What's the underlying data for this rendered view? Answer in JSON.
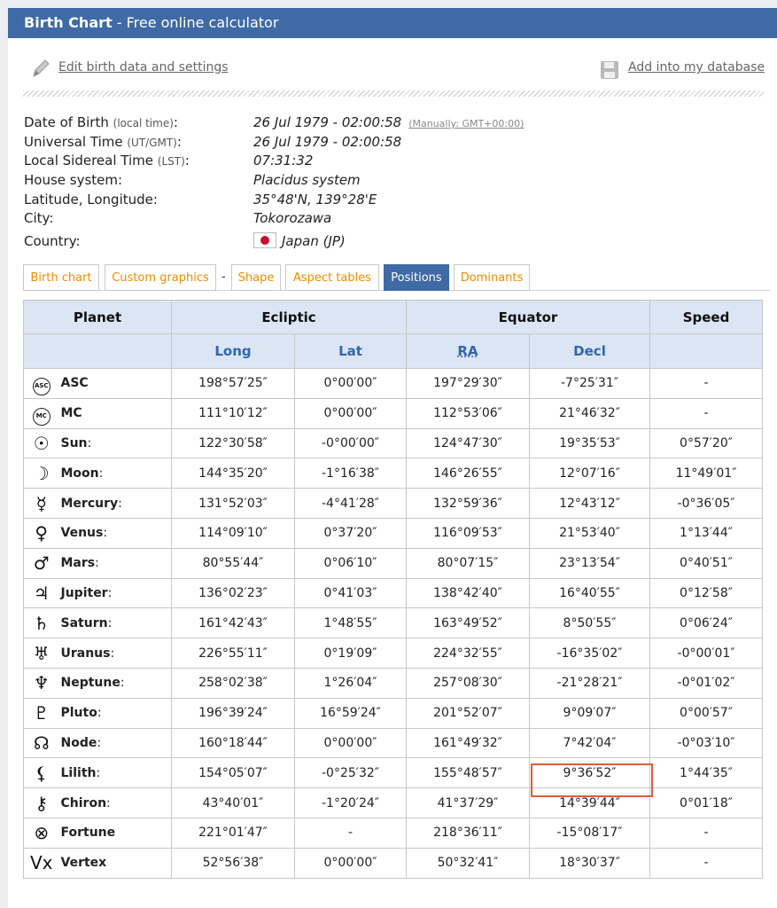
{
  "header": {
    "title": "Birth Chart",
    "subtitle": " - Free online calculator"
  },
  "actions": {
    "edit": "Edit birth data and settings",
    "add": "Add into my database"
  },
  "info": [
    {
      "label": "Date of Birth",
      "note": "(local time)",
      "value": "26 Jul 1979 - 02:00:58",
      "extra": "(Manually: GMT+00:00)"
    },
    {
      "label": "Universal Time",
      "note": "(UT/GMT)",
      "value": "26 Jul 1979 - 02:00:58"
    },
    {
      "label": "Local Sidereal Time",
      "note": "(LST)",
      "value": "07:31:32"
    },
    {
      "label": "House system",
      "note": "",
      "value": "Placidus system"
    },
    {
      "label": "Latitude, Longitude",
      "note": "",
      "value": "35°48'N, 139°28'E"
    },
    {
      "label": "City",
      "note": "",
      "value": "Tokorozawa"
    },
    {
      "label": "Country",
      "note": "",
      "value": "Japan (JP)"
    }
  ],
  "tabs": [
    "Birth chart",
    "Custom graphics",
    "Shape",
    "Aspect tables",
    "Positions",
    "Dominants"
  ],
  "tab_separator": "-",
  "table": {
    "group_headers": [
      "Planet",
      "Ecliptic",
      "Equator",
      "Speed"
    ],
    "sub_headers": [
      "Long",
      "Lat",
      "RA",
      "Decl"
    ],
    "rows": [
      {
        "sym": "ASC",
        "name": "ASC",
        "colon": "",
        "long": "198°57′25″",
        "lat": "0°00′00″",
        "ra": "197°29′30″",
        "decl": "-7°25′31″",
        "speed": "-"
      },
      {
        "sym": "MC",
        "name": "MC",
        "colon": "",
        "long": "111°10′12″",
        "lat": "0°00′00″",
        "ra": "112°53′06″",
        "decl": "21°46′32″",
        "speed": "-"
      },
      {
        "sym": "☉",
        "name": "Sun",
        "colon": ":",
        "long": "122°30′58″",
        "lat": "-0°00′00″",
        "ra": "124°47′30″",
        "decl": "19°35′53″",
        "speed": "0°57′20″"
      },
      {
        "sym": "☽",
        "name": "Moon",
        "colon": ":",
        "long": "144°35′20″",
        "lat": "-1°16′38″",
        "ra": "146°26′55″",
        "decl": "12°07′16″",
        "speed": "11°49′01″"
      },
      {
        "sym": "☿",
        "name": "Mercury",
        "colon": ":",
        "long": "131°52′03″",
        "lat": "-4°41′28″",
        "ra": "132°59′36″",
        "decl": "12°43′12″",
        "speed": "-0°36′05″"
      },
      {
        "sym": "♀",
        "name": "Venus",
        "colon": ":",
        "long": "114°09′10″",
        "lat": "0°37′20″",
        "ra": "116°09′53″",
        "decl": "21°53′40″",
        "speed": "1°13′44″"
      },
      {
        "sym": "♂",
        "name": "Mars",
        "colon": ":",
        "long": "80°55′44″",
        "lat": "0°06′10″",
        "ra": "80°07′15″",
        "decl": "23°13′54″",
        "speed": "0°40′51″"
      },
      {
        "sym": "♃",
        "name": "Jupiter",
        "colon": ":",
        "long": "136°02′23″",
        "lat": "0°41′03″",
        "ra": "138°42′40″",
        "decl": "16°40′55″",
        "speed": "0°12′58″"
      },
      {
        "sym": "♄",
        "name": "Saturn",
        "colon": ":",
        "long": "161°42′43″",
        "lat": "1°48′55″",
        "ra": "163°49′52″",
        "decl": "8°50′55″",
        "speed": "0°06′24″"
      },
      {
        "sym": "♅",
        "name": "Uranus",
        "colon": ":",
        "long": "226°55′11″",
        "lat": "0°19′09″",
        "ra": "224°32′55″",
        "decl": "-16°35′02″",
        "speed": "-0°00′01″"
      },
      {
        "sym": "♆",
        "name": "Neptune",
        "colon": ":",
        "long": "258°02′38″",
        "lat": "1°26′04″",
        "ra": "257°08′30″",
        "decl": "-21°28′21″",
        "speed": "-0°01′02″"
      },
      {
        "sym": "♇",
        "name": "Pluto",
        "colon": ":",
        "long": "196°39′24″",
        "lat": "16°59′24″",
        "ra": "201°52′07″",
        "decl": "9°09′07″",
        "speed": "0°00′57″"
      },
      {
        "sym": "☊",
        "name": "Node",
        "colon": ":",
        "long": "160°18′44″",
        "lat": "0°00′00″",
        "ra": "161°49′32″",
        "decl": "7°42′04″",
        "speed": "-0°03′10″"
      },
      {
        "sym": "⚸",
        "name": "Lilith",
        "colon": ":",
        "long": "154°05′07″",
        "lat": "-0°25′32″",
        "ra": "155°48′57″",
        "decl": "9°36′52″",
        "speed": "1°44′35″"
      },
      {
        "sym": "⚷",
        "name": "Chiron",
        "colon": ":",
        "long": "43°40′01″",
        "lat": "-1°20′24″",
        "ra": "41°37′29″",
        "decl": "14°39′44″",
        "speed": "0°01′18″"
      },
      {
        "sym": "⊗",
        "name": "Fortune",
        "colon": "",
        "long": "221°01′47″",
        "lat": "-",
        "ra": "218°36′11″",
        "decl": "-15°08′17″",
        "speed": "-"
      },
      {
        "sym": "Vx",
        "name": "Vertex",
        "colon": "",
        "long": "52°56′38″",
        "lat": "0°00′00″",
        "ra": "50°32′41″",
        "decl": "18°30′37″",
        "speed": "-"
      }
    ]
  },
  "colors": {
    "header": "#3f6aa5",
    "tab_text": "#f08c00",
    "sub_header_text": "#2e67b0",
    "highlight": "#e05a3a"
  }
}
